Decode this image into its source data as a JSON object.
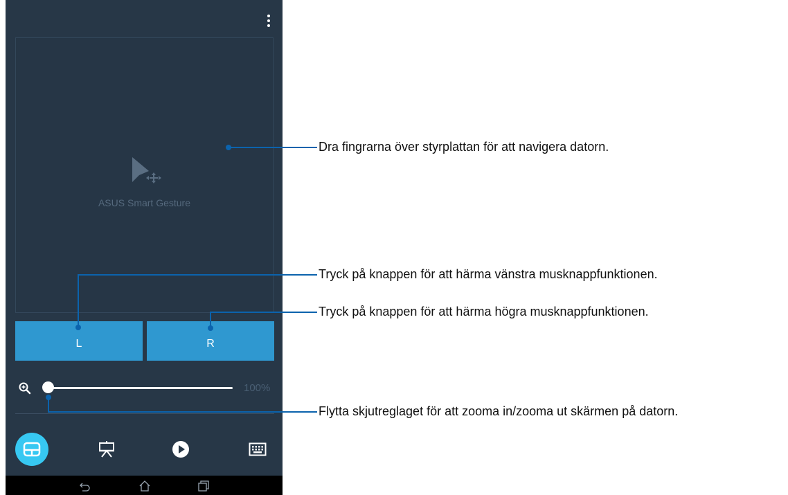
{
  "app": {
    "touchpad_label": "ASUS Smart Gesture",
    "left_button_label": "L",
    "right_button_label": "R",
    "zoom_value": "100%",
    "zoom_level": 0.0,
    "accent_color": "#2f98d0",
    "active_tab_color": "#37c8f2",
    "tabs": [
      {
        "name": "touchpad",
        "icon": "touchpad-icon",
        "active": true
      },
      {
        "name": "presentation",
        "icon": "presentation-icon",
        "active": false
      },
      {
        "name": "media",
        "icon": "play-icon",
        "active": false
      },
      {
        "name": "keyboard",
        "icon": "keyboard-icon",
        "active": false
      }
    ],
    "navbar": [
      "back-icon",
      "home-icon",
      "recent-apps-icon"
    ]
  },
  "callouts": [
    {
      "text": "Dra fingrarna över styrplattan för att navigera datorn."
    },
    {
      "text": "Tryck på knappen för att härma vänstra musknappfunktionen."
    },
    {
      "text": "Tryck på knappen för att härma högra musknappfunktionen."
    },
    {
      "text": "Flytta skjutreglaget för att zooma in/zooma ut skärmen på datorn."
    }
  ]
}
